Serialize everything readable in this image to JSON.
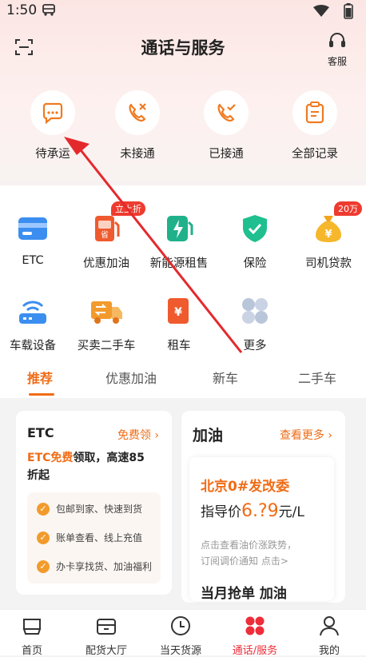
{
  "status": {
    "time": "1:50"
  },
  "header": {
    "title": "通话与服务",
    "service_label": "客服"
  },
  "quick": [
    "待承运",
    "未接通",
    "已接通",
    "全部记录"
  ],
  "services": [
    {
      "label": "ETC"
    },
    {
      "label": "优惠加油",
      "badge": "立上折"
    },
    {
      "label": "新能源租售"
    },
    {
      "label": "保险"
    },
    {
      "label": "司机贷款",
      "badge": "20万"
    },
    {
      "label": "车载设备"
    },
    {
      "label": "买卖二手车"
    },
    {
      "label": "租车"
    },
    {
      "label": "更多"
    }
  ],
  "tabs": [
    "推荐",
    "优惠加油",
    "新车",
    "二手车"
  ],
  "etc_card": {
    "title": "ETC",
    "link": "免费领",
    "promo_hl": "ETC免费",
    "promo_rest": "领取，高速85",
    "promo_line2": "折起",
    "features": [
      "包邮到家、快速到货",
      "账单查看、线上充值",
      "办卡享找货、加油福利"
    ]
  },
  "fuel_card": {
    "title": "加油",
    "link": "查看更多",
    "city": "北京0#发改委",
    "price_label": "指导价",
    "price_value": "6.?9",
    "price_unit": "元/L",
    "note_line1": "点击查看油价涨跌势，",
    "note_line2": "订阅调价通知 点击>",
    "deal": "当月抢单 加油"
  },
  "nav": [
    "首页",
    "配货大厅",
    "当天货源",
    "通话/服务",
    "我的"
  ]
}
